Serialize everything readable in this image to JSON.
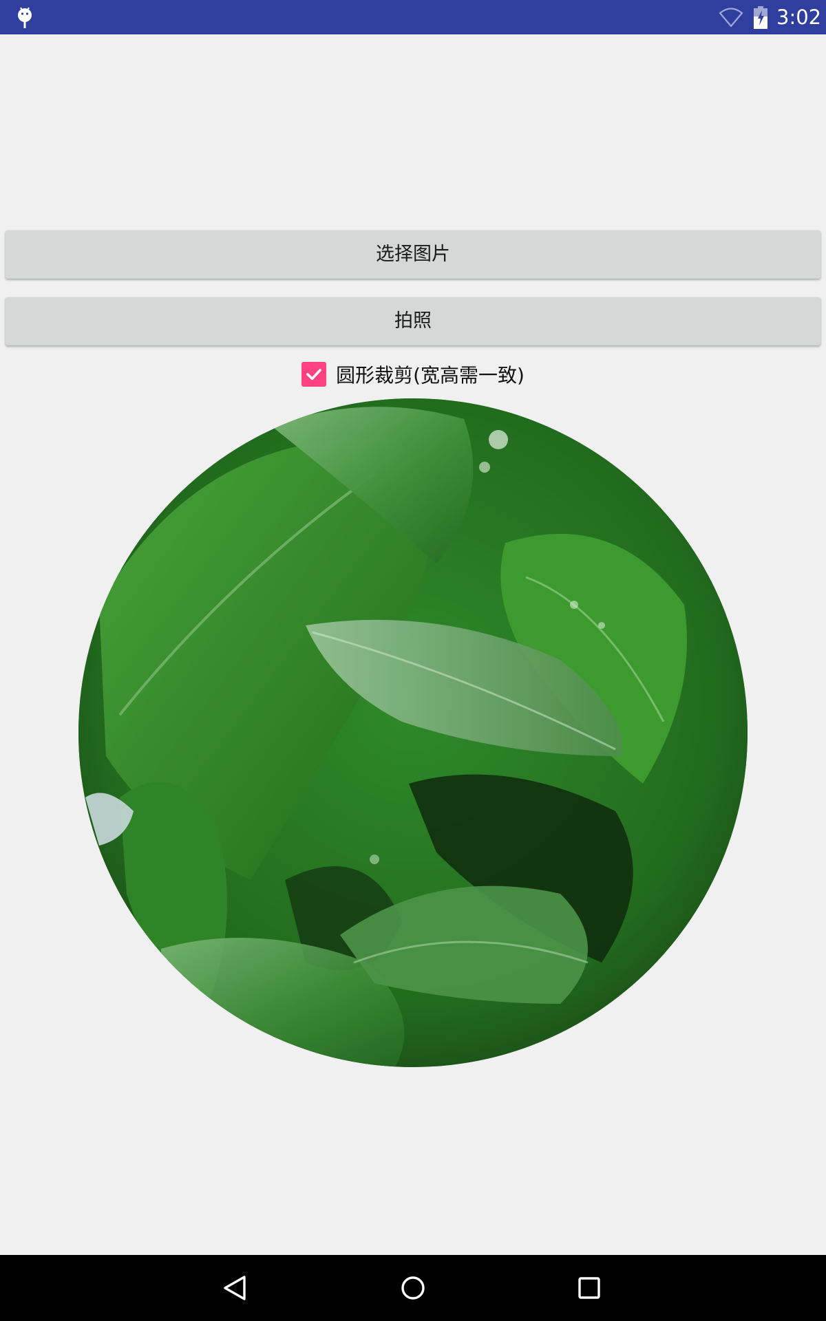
{
  "status_bar": {
    "time": "3:02",
    "background_color": "#303f9f",
    "icons": [
      "android-icon",
      "wifi-icon",
      "battery-charging-icon"
    ]
  },
  "buttons": {
    "select_image": "选择图片",
    "take_photo": "拍照"
  },
  "crop_option": {
    "label": "圆形裁剪(宽高需一致)",
    "checked": true,
    "accent_color": "#ff4081"
  },
  "nav_bar": {
    "icons": [
      "back-icon",
      "home-icon",
      "recent-apps-icon"
    ]
  }
}
